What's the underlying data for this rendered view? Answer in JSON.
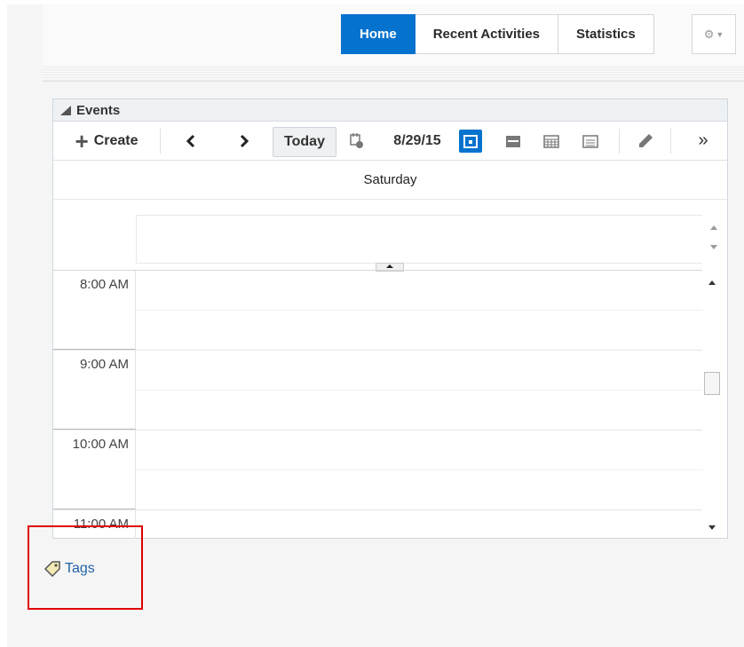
{
  "nav": {
    "tabs": [
      {
        "label": "Home",
        "active": true
      },
      {
        "label": "Recent Activities",
        "active": false
      },
      {
        "label": "Statistics",
        "active": false
      }
    ],
    "settings_icon": "gear-icon"
  },
  "events_panel": {
    "title": "Events",
    "toolbar": {
      "create_label": "Create",
      "prev_icon": "chevron-left-icon",
      "next_icon": "chevron-right-icon",
      "today_label": "Today",
      "date": "8/29/15",
      "overflow_label": "»"
    },
    "day_header": "Saturday",
    "hours": [
      "8:00 AM",
      "9:00 AM",
      "10:00 AM",
      "11:00 AM"
    ]
  },
  "tags_link": "Tags",
  "colors": {
    "accent": "#0572ce",
    "highlight_box": "#e00000",
    "link": "#2263a8"
  }
}
